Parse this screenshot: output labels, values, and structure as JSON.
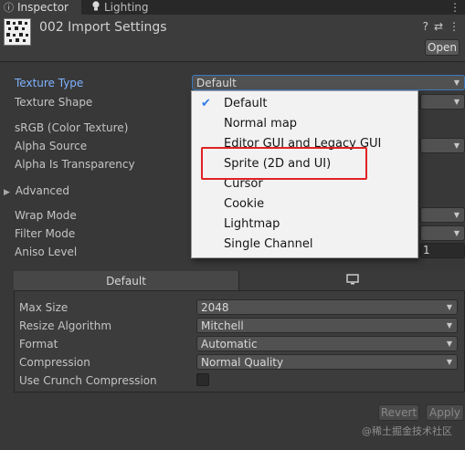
{
  "tabs": {
    "inspector": "Inspector",
    "lighting": "Lighting",
    "menu_glyph": "⋮"
  },
  "header": {
    "title": "002 Import Settings",
    "open_label": "Open",
    "help_glyph": "?",
    "settings_glyph": "⇄",
    "more_glyph": "⋮"
  },
  "properties": {
    "texture_type_label": "Texture Type",
    "texture_type_value": "Default",
    "texture_shape_label": "Texture Shape",
    "srgb_label": "sRGB (Color Texture)",
    "alpha_source_label": "Alpha Source",
    "alpha_transparency_label": "Alpha Is Transparency",
    "advanced_label": "Advanced",
    "wrap_mode_label": "Wrap Mode",
    "filter_mode_label": "Filter Mode",
    "aniso_level_label": "Aniso Level",
    "aniso_value": "1"
  },
  "dropdown_menu": {
    "items": [
      "Default",
      "Normal map",
      "Editor GUI and Legacy GUI",
      "Sprite (2D and UI)",
      "Cursor",
      "Cookie",
      "Lightmap",
      "Single Channel"
    ],
    "selected_index": 0,
    "highlighted_item": "Sprite (2D and UI)"
  },
  "platform": {
    "default_tab": "Default",
    "monitor_icon": "monitor-icon",
    "max_size_label": "Max Size",
    "max_size_value": "2048",
    "resize_algorithm_label": "Resize Algorithm",
    "resize_algorithm_value": "Mitchell",
    "format_label": "Format",
    "format_value": "Automatic",
    "compression_label": "Compression",
    "compression_value": "Normal Quality",
    "crunch_label": "Use Crunch Compression",
    "crunch_checked": false
  },
  "footer": {
    "revert_label": "Revert",
    "apply_label": "Apply",
    "watermark": "@稀土掘金技术社区"
  },
  "colors": {
    "background": "#383838",
    "accent_blue": "#7fb3ff",
    "highlight_red": "#e02222",
    "menu_bg": "#f2f2f2"
  }
}
